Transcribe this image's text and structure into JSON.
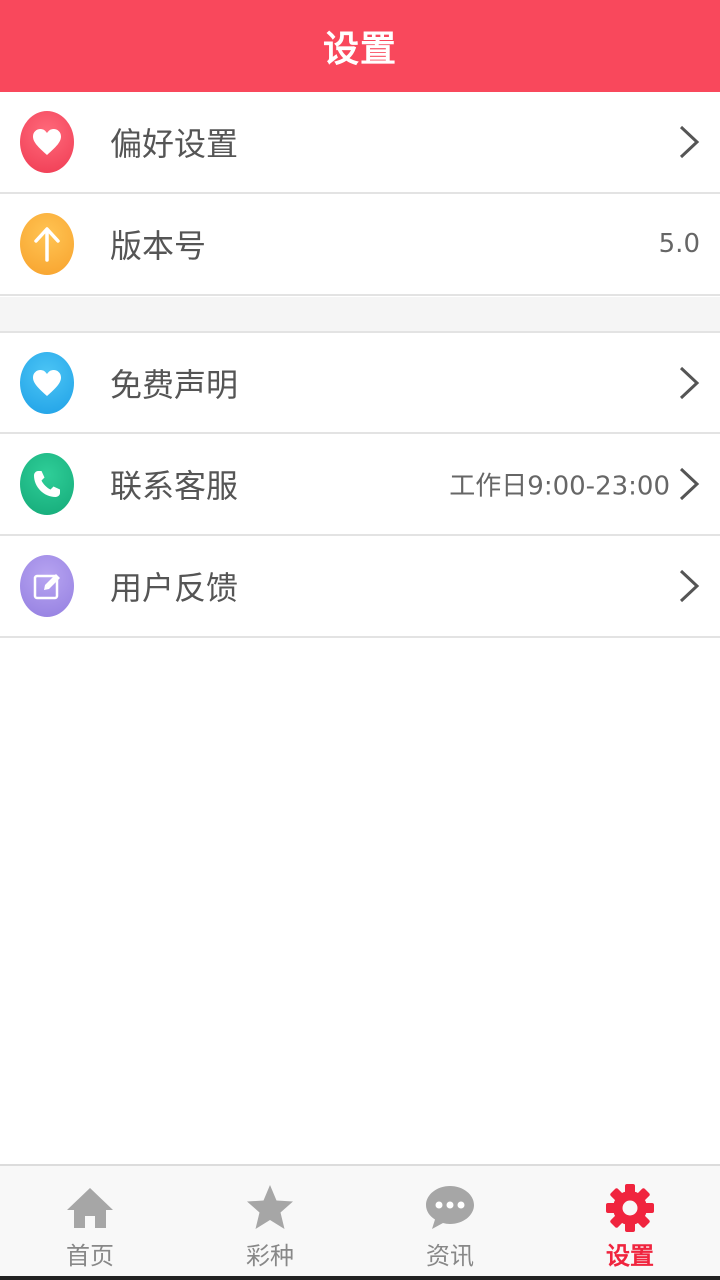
{
  "header": {
    "title": "设置"
  },
  "groups": [
    {
      "items": [
        {
          "label": "偏好设置",
          "value": "",
          "icon": "heart-icon",
          "color": "#f9485c",
          "chevron": true
        },
        {
          "label": "版本号",
          "value": "5.0",
          "icon": "arrow-up-icon",
          "color": "#f7a12c",
          "chevron": false
        }
      ]
    },
    {
      "items": [
        {
          "label": "免费声明",
          "value": "",
          "icon": "heart-icon",
          "color": "#1ea0e6",
          "chevron": true
        },
        {
          "label": "联系客服",
          "value": "工作日9:00-23:00",
          "icon": "phone-icon",
          "color": "#14a978",
          "chevron": true
        },
        {
          "label": "用户反馈",
          "value": "",
          "icon": "edit-icon",
          "color": "#937ee0",
          "chevron": true
        }
      ]
    }
  ],
  "tabs": [
    {
      "label": "首页",
      "icon": "home-icon",
      "active": false
    },
    {
      "label": "彩种",
      "icon": "star-icon",
      "active": false
    },
    {
      "label": "资讯",
      "icon": "chat-bubble-icon",
      "active": false
    },
    {
      "label": "设置",
      "icon": "gear-icon",
      "active": true
    }
  ],
  "colors": {
    "accent": "#f9485c",
    "active_tab": "#f0243e",
    "inactive_tab": "#a6a6a6"
  }
}
